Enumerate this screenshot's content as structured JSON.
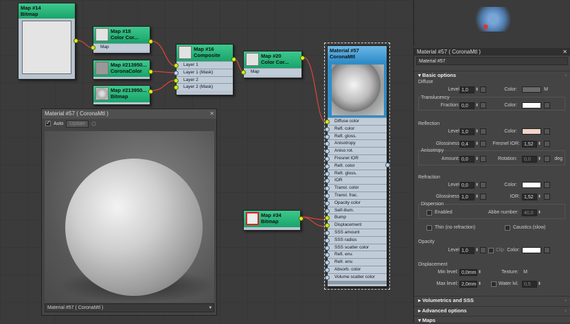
{
  "nodes": {
    "map14": {
      "title": "Map #14",
      "sub": "Bitmap"
    },
    "map18": {
      "title": "Map #18",
      "sub": "Color Cor...",
      "slot": "Map"
    },
    "map213a": {
      "title": "Map #213950...",
      "sub": "CoronaColor"
    },
    "map213b": {
      "title": "Map #213950...",
      "sub": "Bitmap"
    },
    "map16": {
      "title": "Map #16",
      "sub": "Composite",
      "slots": [
        "Layer 1",
        "Layer 1 (Mask)",
        "Layer 2",
        "Layer 2 (Mask)"
      ]
    },
    "map20": {
      "title": "Map #20",
      "sub": "Color Cor...",
      "slot": "Map"
    },
    "map34": {
      "title": "Map #34",
      "sub": "Bitmap"
    },
    "mat57": {
      "title": "Material #57",
      "sub": "CoronaMtl",
      "slots": [
        "Diffuse color",
        "Refl. color",
        "Refl. gloss.",
        "Anisotropy",
        "Aniso rot.",
        "Fresnel IOR",
        "Refr. color",
        "Refr. gloss.",
        "IOR",
        "Transl. color",
        "Transl. frac.",
        "Opacity color",
        "Self-illum.",
        "Bump",
        "Displacement",
        "SSS amount",
        "SSS radius",
        "SSS scatter color",
        "Refl. env.",
        "Refr. env.",
        "Absorb. color",
        "Volume scatter color"
      ]
    }
  },
  "preview": {
    "title": "Material #57  ( CoronaMtl )",
    "auto": "Auto",
    "update": "Update",
    "dropdown": "Material #57  ( CoronaMtl )"
  },
  "panel": {
    "title": "Material #57  ( CoronaMtl )",
    "name": "Material #57",
    "basic": "Basic options",
    "diffuse": {
      "group": "Diffuse",
      "level_lbl": "Level:",
      "level": "1,0",
      "color_lbl": "Color:",
      "m": "M",
      "transl": "Translucency",
      "frac_lbl": "Fraction:",
      "frac": "0,0",
      "color2_lbl": "Color:"
    },
    "reflection": {
      "group": "Reflection",
      "level_lbl": "Level:",
      "level": "1,0",
      "color_lbl": "Color:",
      "gloss_lbl": "Glossiness:",
      "gloss": "0,4",
      "fior_lbl": "Fresnel IOR:",
      "fior": "1,52",
      "aniso": "Anisotropy",
      "amount_lbl": "Amount:",
      "amount": "0,0",
      "rot_lbl": "Rotation:",
      "rot": "0,0",
      "deg": "deg"
    },
    "refraction": {
      "group": "Refraction",
      "level_lbl": "Level:",
      "level": "0,0",
      "color_lbl": "Color:",
      "gloss_lbl": "Glossiness:",
      "gloss": "1,0",
      "ior_lbl": "IOR:",
      "ior": "1,52",
      "disp": "Dispersion",
      "enabled": "Enabled",
      "abbe_lbl": "Abbe number:",
      "abbe": "40,0",
      "thin": "Thin (no refraction)",
      "caustics": "Caustics (slow)"
    },
    "opacity": {
      "group": "Opacity",
      "level_lbl": "Level:",
      "level": "1,0",
      "clip": "Clip",
      "color_lbl": "Color:"
    },
    "displacement": {
      "group": "Displacement",
      "min_lbl": "Min level:",
      "min": "0,0mm",
      "tex_lbl": "Texture:",
      "m": "M",
      "max_lbl": "Max level:",
      "max": "2,0mm",
      "water": "Water lvl.",
      "water_val": "0,5"
    },
    "sections": [
      "Volumetrics and SSS",
      "Advanced options",
      "Maps"
    ]
  },
  "colors": {
    "node_green": "#1fae72",
    "node_blue": "#3a97d2",
    "wire": "#e0443a",
    "diffuse_swatch": "#6a6a6a",
    "refl_swatch": "#f2d4c8",
    "white": "#ffffff"
  }
}
